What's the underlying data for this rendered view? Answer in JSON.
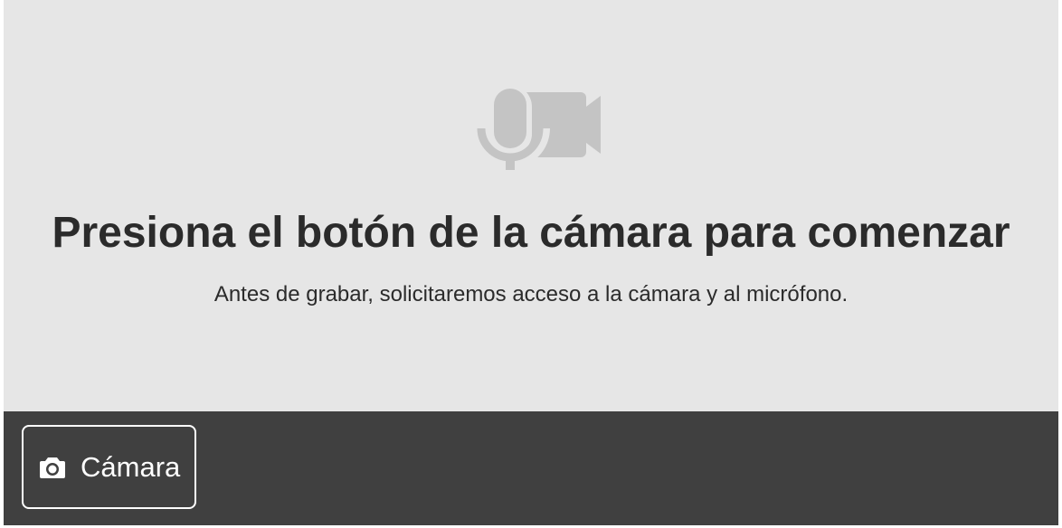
{
  "stage": {
    "icon": "mic-video-icon",
    "title": "Presiona el botón de la cámara para comenzar",
    "subtitle": "Antes de grabar, solicitaremos acceso a la cámara y al micrófono."
  },
  "toolbar": {
    "camera_button": {
      "icon": "camera-icon",
      "label": "Cámara"
    }
  },
  "colors": {
    "stage_bg": "#e6e6e6",
    "toolbar_bg": "#404040",
    "icon_gray": "#c4c4c4",
    "text_dark": "#2b2b2b",
    "button_fg": "#ffffff"
  }
}
